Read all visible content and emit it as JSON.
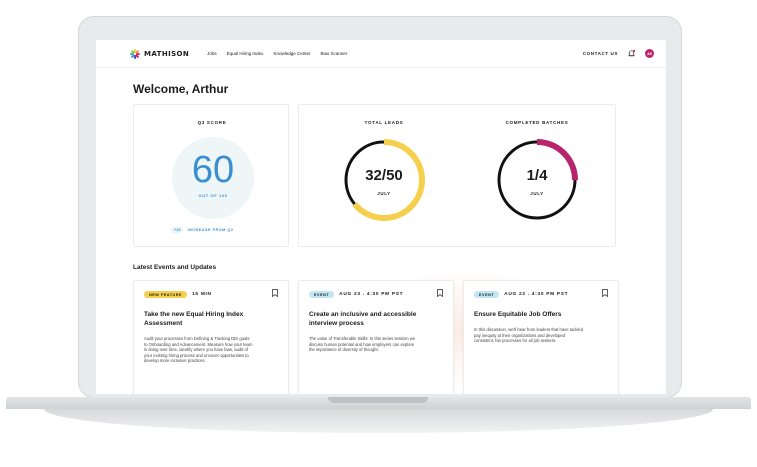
{
  "nav": {
    "brand": "MATHISON",
    "links": [
      "Jobs",
      "Equal Hiring Index",
      "Knowledge Center",
      "Bias Scanner"
    ],
    "contact": "CONTACT US",
    "avatar_initials": "AS",
    "avatar_color": "#b8246b"
  },
  "welcome": "Welcome, Arthur",
  "score": {
    "title": "Q3 SCORE",
    "value": "60",
    "sub": "OUT OF 100",
    "increase_badge": "+10",
    "increase_text": "INCREASE FROM Q2",
    "accent": "#3a8fd1"
  },
  "leads": {
    "title": "TOTAL LEADS",
    "value": "32/50",
    "sub": "JULY",
    "progress": 0.64,
    "color": "#f6d04d"
  },
  "batches": {
    "title": "COMPLETED BATCHES",
    "value": "1/4",
    "sub": "JULY",
    "progress": 0.25,
    "color": "#b8246b"
  },
  "events_title": "Latest Events and Updates",
  "events": [
    {
      "tag": "NEW FEATURE",
      "tag_color": "#f6d04d",
      "meta": "15 MIN",
      "title": "Take the new Equal Hiring Index Assessment",
      "body": "Audit your processes from Defining & Tracking DEI goals to Onboarding and Advancement. Measure how your team is doing over time, identify where you have bias, audit of your existing hiring process and uncover opportunities to develop more inclusive practices."
    },
    {
      "tag": "EVENT",
      "tag_color": "#bfe6f2",
      "meta": "AUG 23 . 4:30 PM PST",
      "title": "Create an inclusive and accessible interview process",
      "body": "The value of Transferable Skills: In this series session we discuss human potential and how employers can explore the importance of diversity of thought."
    },
    {
      "tag": "EVENT",
      "tag_color": "#bfe6f2",
      "meta": "AUG 22 . 4:30 PM PST",
      "title": "Ensure Equitable Job Offers",
      "body": "In this discussion, we'll hear from leaders that have tackled pay inequity at their organizations and developed consistent, fair processes for all job seekers."
    }
  ]
}
